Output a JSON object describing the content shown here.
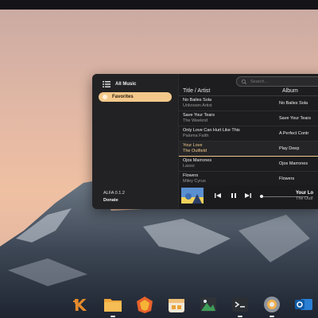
{
  "sidebar": {
    "items": [
      {
        "label": "All Music",
        "icon": "list-icon"
      },
      {
        "label": "Favorites",
        "icon": "star-icon"
      }
    ],
    "version": "ALFA 0.1.2",
    "donate": "Donate"
  },
  "search": {
    "placeholder": "Search..."
  },
  "table": {
    "columns": [
      "Title / Artist",
      "Album"
    ],
    "rows": [
      {
        "title": "No Bailes Sola",
        "artist": "Unknown Artist",
        "album": "No Bailes Sola"
      },
      {
        "title": "Save Your Tears",
        "artist": "The Weeknd",
        "album": "Save Your Tears"
      },
      {
        "title": "Only Love Can Hurt Like This",
        "artist": "Paloma Faith",
        "album": "A Perfect Contr"
      },
      {
        "title": "Your Love",
        "artist": "The Outfield",
        "album": "Play Deep"
      },
      {
        "title": "Ojos Marrones",
        "artist": "Lasso",
        "album": "Ojos Marrones"
      },
      {
        "title": "Flowers",
        "artist": "Miley Cyrus",
        "album": "Flowers"
      }
    ],
    "active_row": "Your Love"
  },
  "now_playing": {
    "title": "Your Lo",
    "artist": "The Outf",
    "progress": 0.02
  },
  "colors": {
    "accent": "#f3c98b",
    "window_bg": "#1d1d1f"
  },
  "dock": [
    {
      "icon": "kde-icon"
    },
    {
      "icon": "files-icon"
    },
    {
      "icon": "firefox-icon"
    },
    {
      "icon": "store-icon"
    },
    {
      "icon": "image-viewer-icon"
    },
    {
      "icon": "terminal-icon"
    },
    {
      "icon": "settings-icon"
    },
    {
      "icon": "outlook-icon"
    }
  ]
}
